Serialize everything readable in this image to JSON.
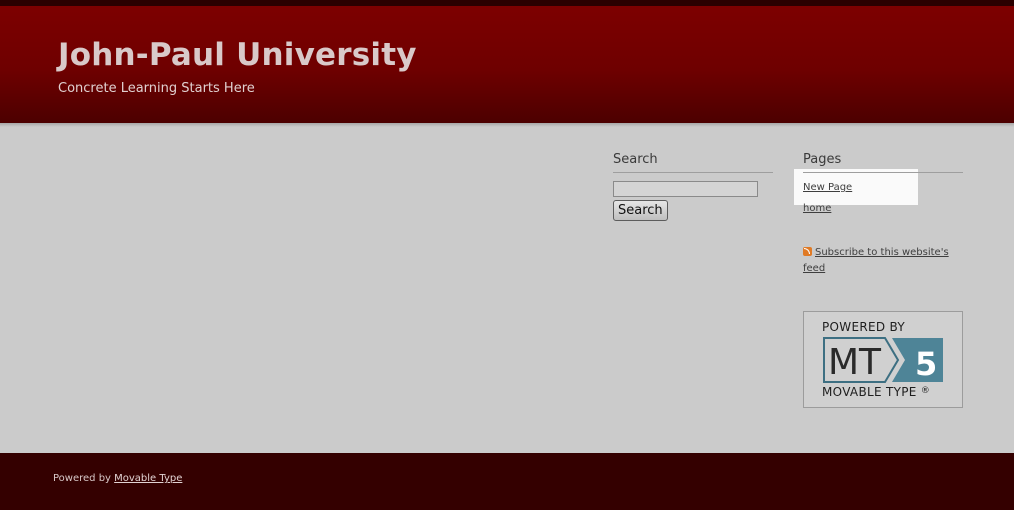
{
  "header": {
    "title": "John-Paul University",
    "tagline": "Concrete Learning Starts Here"
  },
  "search_widget": {
    "heading": "Search",
    "input_value": "",
    "button_label": "Search"
  },
  "pages_widget": {
    "heading": "Pages",
    "items": [
      {
        "label": "New Page"
      },
      {
        "label": "home"
      }
    ]
  },
  "feed": {
    "icon": "rss-feed-icon",
    "label": "Subscribe to this website's feed"
  },
  "mt_badge": {
    "powered_text": "POWERED BY",
    "logo_letters": "MT",
    "logo_version": "5",
    "brand_text": "MOVABLE TYPE",
    "registered": "®"
  },
  "footer": {
    "prefix": "Powered by ",
    "link_label": "Movable Type"
  },
  "colors": {
    "header_red": "#7d0000",
    "footer_dark": "#340000",
    "body_gray": "#cbcbcb",
    "mt_teal": "#4e8497"
  }
}
